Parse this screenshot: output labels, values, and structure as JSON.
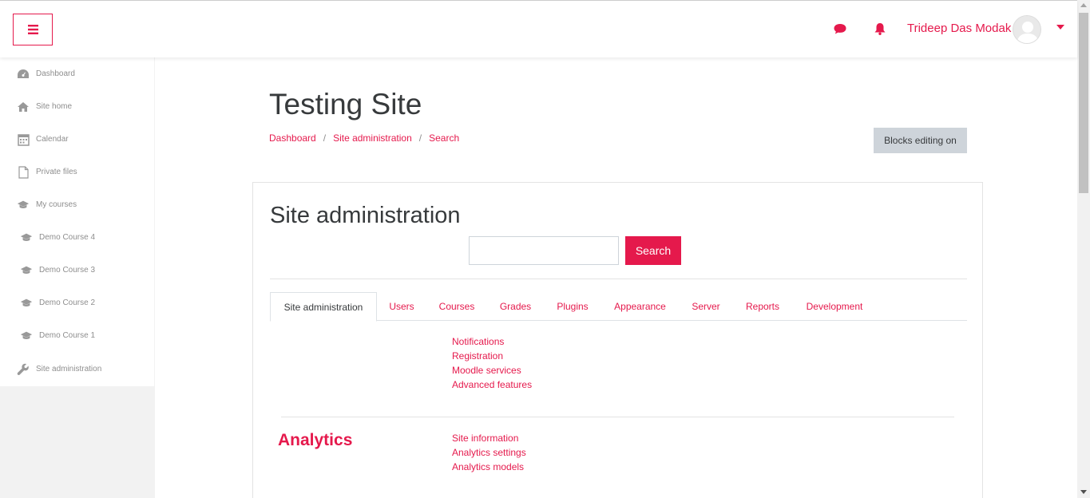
{
  "header": {
    "menu_icon": "hamburger-icon",
    "messages_icon": "chat-bubble-icon",
    "notifications_icon": "bell-icon",
    "user_name": "Trideep Das Modak",
    "accent_color": "#e5194c"
  },
  "sidebar": {
    "items": [
      {
        "label": "Dashboard",
        "icon": "dashboard-icon"
      },
      {
        "label": "Site home",
        "icon": "home-icon"
      },
      {
        "label": "Calendar",
        "icon": "calendar-icon"
      },
      {
        "label": "Private files",
        "icon": "file-icon"
      },
      {
        "label": "My courses",
        "icon": "graduation-cap-icon"
      },
      {
        "label": "Demo Course 4",
        "icon": "graduation-cap-icon"
      },
      {
        "label": "Demo Course 3",
        "icon": "graduation-cap-icon"
      },
      {
        "label": "Demo Course 2",
        "icon": "graduation-cap-icon"
      },
      {
        "label": "Demo Course 1",
        "icon": "graduation-cap-icon"
      },
      {
        "label": "Site administration",
        "icon": "wrench-icon"
      }
    ]
  },
  "page": {
    "title": "Testing Site",
    "breadcrumb": [
      "Dashboard",
      "Site administration",
      "Search"
    ],
    "breadcrumb_separator": "/",
    "blocks_editing_label": "Blocks editing on"
  },
  "admin": {
    "title": "Site administration",
    "search_value": "",
    "search_button": "Search",
    "tabs": [
      "Site administration",
      "Users",
      "Courses",
      "Grades",
      "Plugins",
      "Appearance",
      "Server",
      "Reports",
      "Development"
    ],
    "active_tab": "Site administration",
    "general_links": [
      "Notifications",
      "Registration",
      "Moodle services",
      "Advanced features"
    ],
    "analytics": {
      "heading": "Analytics",
      "links": [
        "Site information",
        "Analytics settings",
        "Analytics models"
      ]
    }
  }
}
